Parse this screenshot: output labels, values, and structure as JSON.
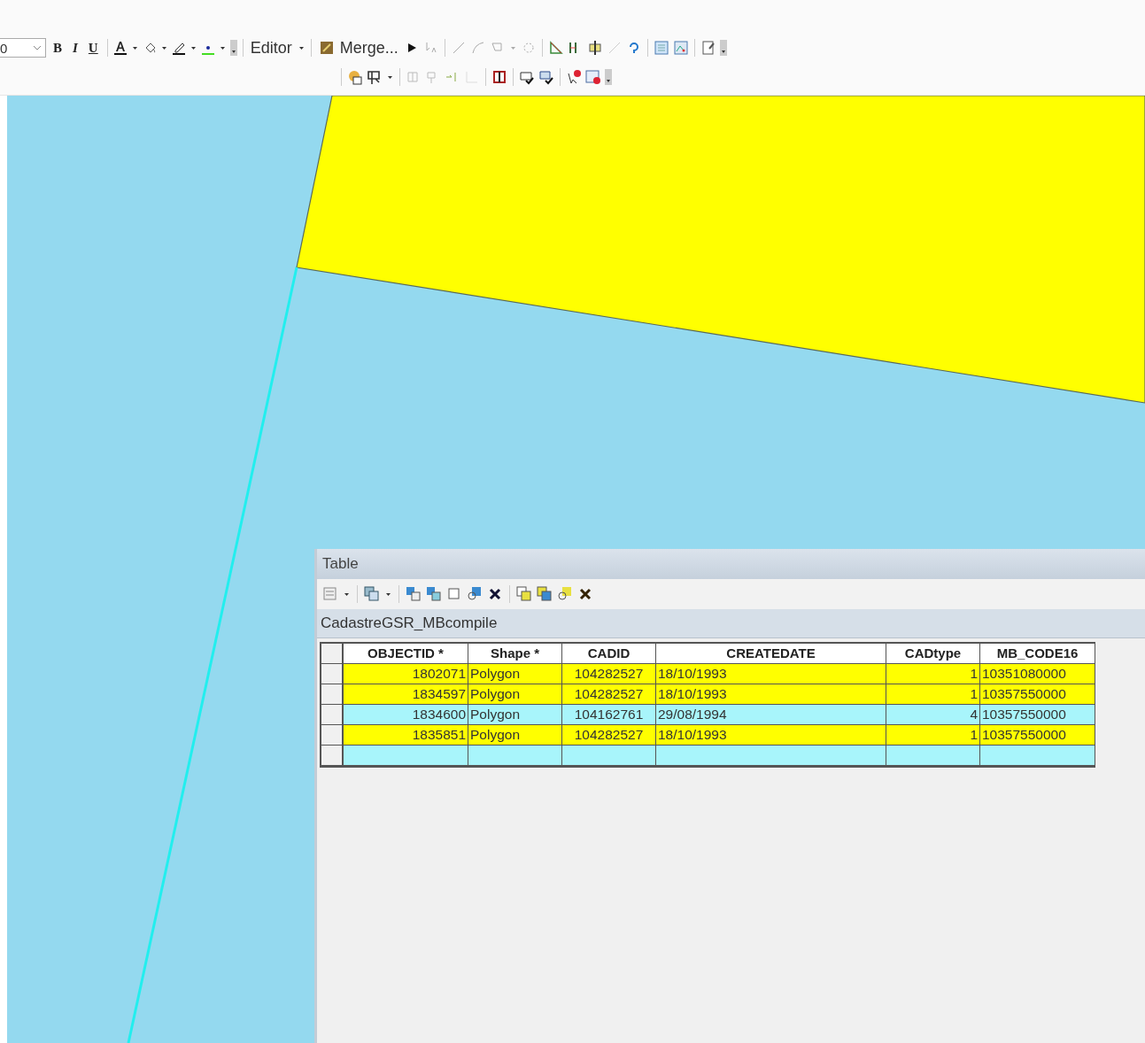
{
  "toolbar": {
    "font_size": "0",
    "bold": "B",
    "italic": "I",
    "underline": "U",
    "editor_menu": "Editor",
    "merge_button": "Merge..."
  },
  "table_window": {
    "title": "Table",
    "layer_tab": "CadastreGSR_MBcompile",
    "columns": [
      "OBJECTID *",
      "Shape *",
      "CADID",
      "CREATEDATE",
      "CADtype",
      "MB_CODE16"
    ],
    "rows": [
      {
        "selected": true,
        "cells": [
          "1802071",
          "Polygon",
          "104282527",
          "18/10/1993",
          "1",
          "10351080000"
        ]
      },
      {
        "selected": true,
        "cells": [
          "1834597",
          "Polygon",
          "104282527",
          "18/10/1993",
          "1",
          "10357550000"
        ]
      },
      {
        "selected": false,
        "cells": [
          "1834600",
          "Polygon",
          "104162761",
          "29/08/1994",
          "4",
          "10357550000"
        ]
      },
      {
        "selected": true,
        "cells": [
          "1835851",
          "Polygon",
          "104282527",
          "18/10/1993",
          "1",
          "10357550000"
        ]
      }
    ],
    "blank_row": true
  }
}
